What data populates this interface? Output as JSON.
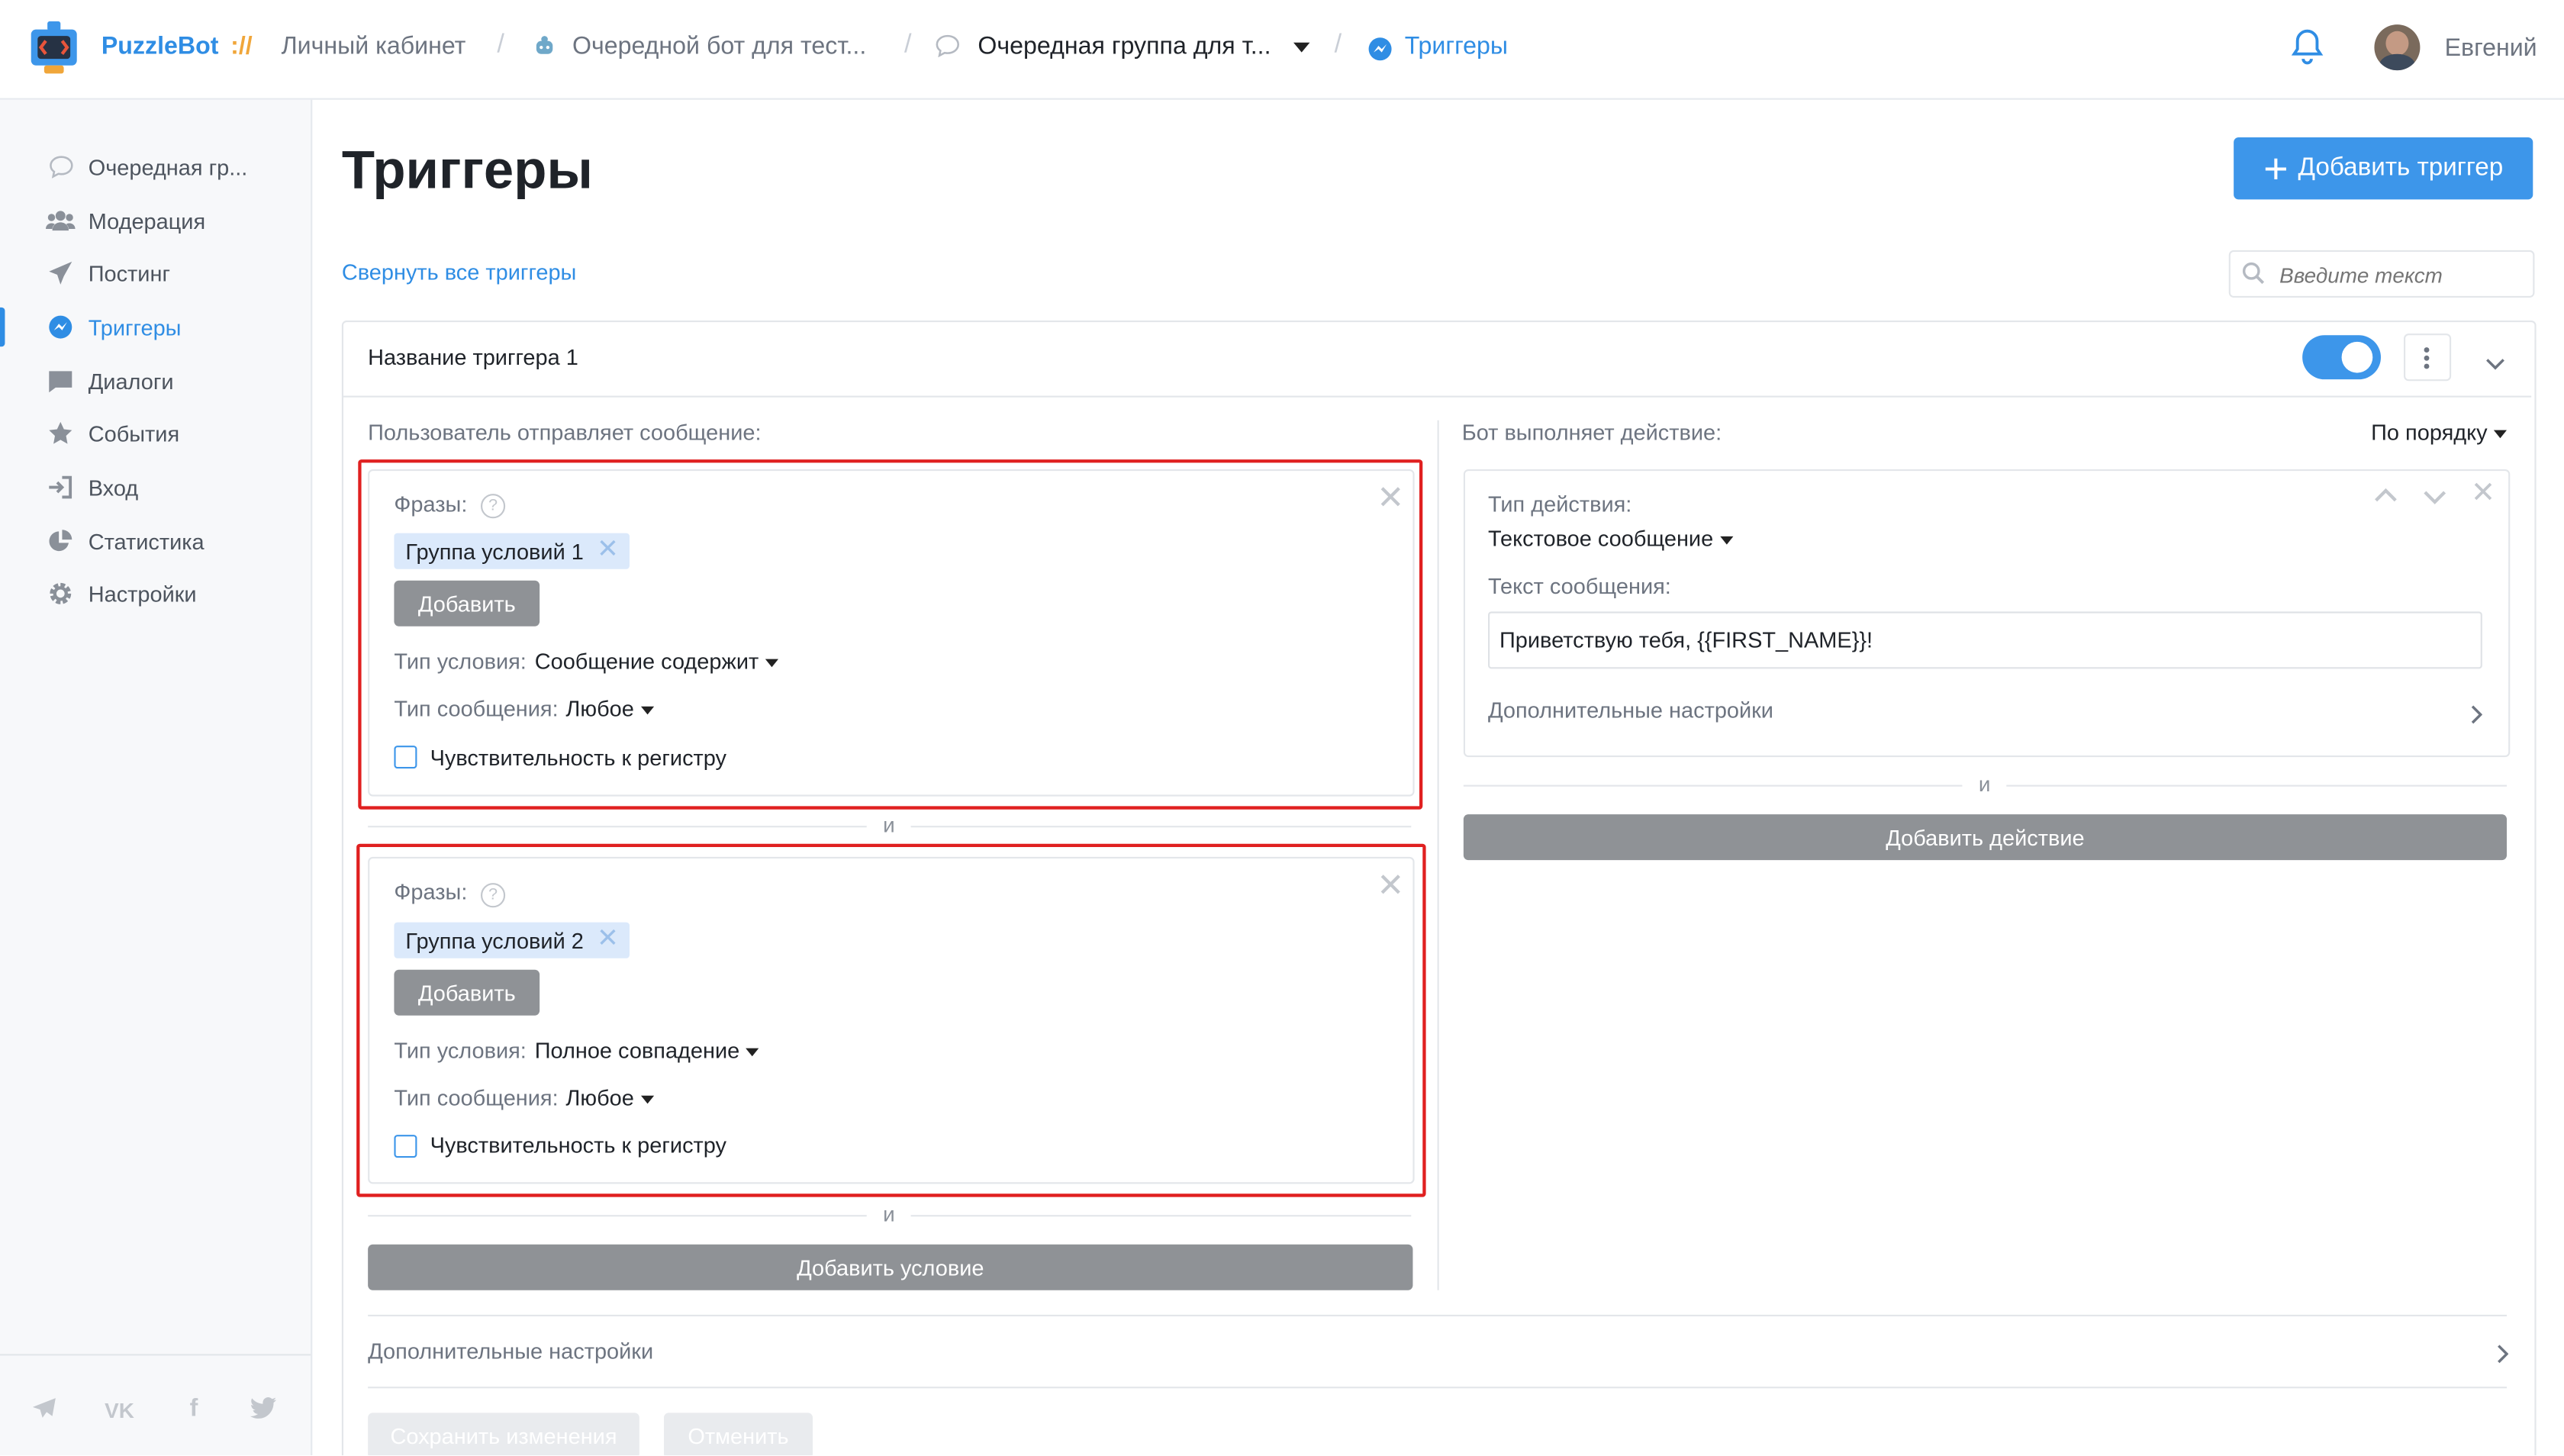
{
  "header": {
    "brand": "PuzzleBot",
    "brand_sep": "://",
    "crumbs": [
      "Личный кабинет",
      "Очередной бот для тест...",
      "Очередная группа для т...",
      "Триггеры"
    ],
    "user_name": "Евгений"
  },
  "sidebar": {
    "items": [
      {
        "label": "Очередная гр...",
        "icon": "chat-bubble-icon"
      },
      {
        "label": "Модерация",
        "icon": "users-icon"
      },
      {
        "label": "Постинг",
        "icon": "paper-plane-icon"
      },
      {
        "label": "Триггеры",
        "icon": "messenger-icon"
      },
      {
        "label": "Диалоги",
        "icon": "message-icon"
      },
      {
        "label": "События",
        "icon": "star-icon"
      },
      {
        "label": "Вход",
        "icon": "sign-in-icon"
      },
      {
        "label": "Статистика",
        "icon": "pie-chart-icon"
      },
      {
        "label": "Настройки",
        "icon": "gear-icon"
      }
    ],
    "active_index": 3,
    "social": [
      "telegram-icon",
      "vk-icon",
      "facebook-icon",
      "twitter-icon"
    ]
  },
  "page": {
    "title": "Триггеры",
    "add_trigger": "Добавить триггер",
    "collapse_all": "Свернуть все триггеры",
    "search_placeholder": "Введите текст"
  },
  "trigger": {
    "name": "Название триггера 1",
    "enabled": true,
    "user_sends": "Пользователь отправляет сообщение:",
    "bot_does": "Бот выполняет действие:",
    "order": "По порядку",
    "and": "и",
    "conditions": [
      {
        "phrases_label": "Фразы:",
        "tag": "Группа условий 1",
        "add": "Добавить",
        "cond_type_label": "Тип условия:",
        "cond_type_value": "Сообщение содержит",
        "msg_type_label": "Тип сообщения:",
        "msg_type_value": "Любое",
        "case_sensitive": "Чувствительность к регистру"
      },
      {
        "phrases_label": "Фразы:",
        "tag": "Группа условий 2",
        "add": "Добавить",
        "cond_type_label": "Тип условия:",
        "cond_type_value": "Полное совпадение",
        "msg_type_label": "Тип сообщения:",
        "msg_type_value": "Любое",
        "case_sensitive": "Чувствительность к регистру"
      }
    ],
    "add_condition": "Добавить условие",
    "action": {
      "type_label": "Тип действия:",
      "type_value": "Текстовое сообщение",
      "text_label": "Текст сообщения:",
      "text_value": "Приветствую тебя, {{FIRST_NAME}}!",
      "extra": "Дополнительные настройки"
    },
    "add_action": "Добавить действие",
    "extra_settings": "Дополнительные настройки",
    "save": "Сохранить изменения",
    "cancel": "Отменить"
  },
  "colors": {
    "accent": "#3d96ea",
    "highlight": "#e02020"
  }
}
